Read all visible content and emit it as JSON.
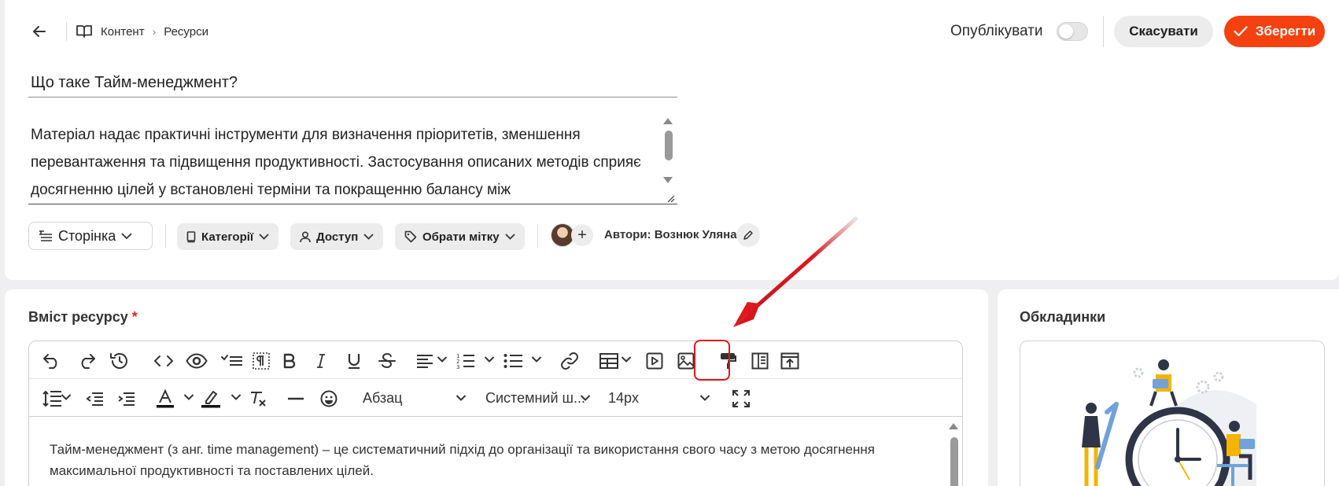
{
  "header": {
    "breadcrumb": [
      "Контент",
      "Ресурси"
    ],
    "publish_label": "Опублікувати",
    "publish_enabled": false,
    "cancel_label": "Скасувати",
    "save_label": "Зберегти"
  },
  "resource": {
    "title": "Що таке Тайм-менеджмент?",
    "description": "Матеріал надає практичні інструменти для визначення пріоритетів, зменшення перевантаження та підвищення продуктивності. Застосування описаних методів сприяє досягненню цілей у встановлені терміни та покращенню балансу між"
  },
  "meta": {
    "type_label": "Сторінка",
    "category_label": "Категорії",
    "access_label": "Доступ",
    "tag_label": "Обрати мітку",
    "authors_label": "Автори: Вознюк Уляна"
  },
  "content": {
    "label": "Вміст ресурсу",
    "required_mark": "*",
    "paragraph_style": "Абзац",
    "font_family": "Системний ш...",
    "font_size": "14px",
    "body_text": "Тайм-менеджмент (з анг. time management) – це систематичний підхід до організації та використання свого часу з метою досягнення максимальної продуктивності та поставлених цілей."
  },
  "covers": {
    "label": "Обкладинки"
  },
  "colors": {
    "accent": "#f5410f",
    "highlight": "#e0171f",
    "arrow": "#e0171f"
  },
  "icons": [
    "back-arrow-icon",
    "book-icon",
    "chevron-right-icon",
    "check-icon",
    "page-type-icon",
    "chevron-down-icon",
    "tablet-icon",
    "user-icon",
    "tag-icon",
    "plus-icon",
    "pencil-icon",
    "undo-icon",
    "redo-icon",
    "history-icon",
    "code-icon",
    "eye-icon",
    "checklist-icon",
    "paragraph-icon",
    "bold-icon",
    "italic-icon",
    "underline-icon",
    "strikethrough-icon",
    "align-icon",
    "numbered-list-icon",
    "bullet-list-icon",
    "link-icon",
    "table-icon",
    "video-icon",
    "image-icon",
    "format-painter-icon",
    "template-icon",
    "preview-icon",
    "line-height-icon",
    "outdent-icon",
    "indent-icon",
    "text-color-icon",
    "highlight-color-icon",
    "clear-format-icon",
    "horizontal-rule-icon",
    "emoji-icon",
    "fullscreen-icon"
  ]
}
